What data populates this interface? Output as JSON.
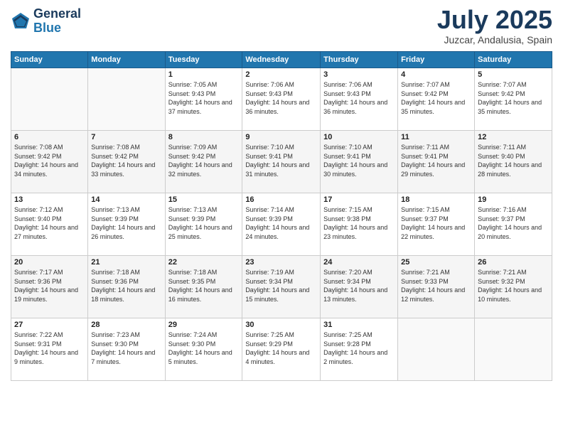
{
  "logo": {
    "line1": "General",
    "line2": "Blue"
  },
  "title": "July 2025",
  "subtitle": "Juzcar, Andalusia, Spain",
  "days_header": [
    "Sunday",
    "Monday",
    "Tuesday",
    "Wednesday",
    "Thursday",
    "Friday",
    "Saturday"
  ],
  "weeks": [
    [
      {
        "day": "",
        "sunrise": "",
        "sunset": "",
        "daylight": ""
      },
      {
        "day": "",
        "sunrise": "",
        "sunset": "",
        "daylight": ""
      },
      {
        "day": "1",
        "sunrise": "Sunrise: 7:05 AM",
        "sunset": "Sunset: 9:43 PM",
        "daylight": "Daylight: 14 hours and 37 minutes."
      },
      {
        "day": "2",
        "sunrise": "Sunrise: 7:06 AM",
        "sunset": "Sunset: 9:43 PM",
        "daylight": "Daylight: 14 hours and 36 minutes."
      },
      {
        "day": "3",
        "sunrise": "Sunrise: 7:06 AM",
        "sunset": "Sunset: 9:43 PM",
        "daylight": "Daylight: 14 hours and 36 minutes."
      },
      {
        "day": "4",
        "sunrise": "Sunrise: 7:07 AM",
        "sunset": "Sunset: 9:42 PM",
        "daylight": "Daylight: 14 hours and 35 minutes."
      },
      {
        "day": "5",
        "sunrise": "Sunrise: 7:07 AM",
        "sunset": "Sunset: 9:42 PM",
        "daylight": "Daylight: 14 hours and 35 minutes."
      }
    ],
    [
      {
        "day": "6",
        "sunrise": "Sunrise: 7:08 AM",
        "sunset": "Sunset: 9:42 PM",
        "daylight": "Daylight: 14 hours and 34 minutes."
      },
      {
        "day": "7",
        "sunrise": "Sunrise: 7:08 AM",
        "sunset": "Sunset: 9:42 PM",
        "daylight": "Daylight: 14 hours and 33 minutes."
      },
      {
        "day": "8",
        "sunrise": "Sunrise: 7:09 AM",
        "sunset": "Sunset: 9:42 PM",
        "daylight": "Daylight: 14 hours and 32 minutes."
      },
      {
        "day": "9",
        "sunrise": "Sunrise: 7:10 AM",
        "sunset": "Sunset: 9:41 PM",
        "daylight": "Daylight: 14 hours and 31 minutes."
      },
      {
        "day": "10",
        "sunrise": "Sunrise: 7:10 AM",
        "sunset": "Sunset: 9:41 PM",
        "daylight": "Daylight: 14 hours and 30 minutes."
      },
      {
        "day": "11",
        "sunrise": "Sunrise: 7:11 AM",
        "sunset": "Sunset: 9:41 PM",
        "daylight": "Daylight: 14 hours and 29 minutes."
      },
      {
        "day": "12",
        "sunrise": "Sunrise: 7:11 AM",
        "sunset": "Sunset: 9:40 PM",
        "daylight": "Daylight: 14 hours and 28 minutes."
      }
    ],
    [
      {
        "day": "13",
        "sunrise": "Sunrise: 7:12 AM",
        "sunset": "Sunset: 9:40 PM",
        "daylight": "Daylight: 14 hours and 27 minutes."
      },
      {
        "day": "14",
        "sunrise": "Sunrise: 7:13 AM",
        "sunset": "Sunset: 9:39 PM",
        "daylight": "Daylight: 14 hours and 26 minutes."
      },
      {
        "day": "15",
        "sunrise": "Sunrise: 7:13 AM",
        "sunset": "Sunset: 9:39 PM",
        "daylight": "Daylight: 14 hours and 25 minutes."
      },
      {
        "day": "16",
        "sunrise": "Sunrise: 7:14 AM",
        "sunset": "Sunset: 9:39 PM",
        "daylight": "Daylight: 14 hours and 24 minutes."
      },
      {
        "day": "17",
        "sunrise": "Sunrise: 7:15 AM",
        "sunset": "Sunset: 9:38 PM",
        "daylight": "Daylight: 14 hours and 23 minutes."
      },
      {
        "day": "18",
        "sunrise": "Sunrise: 7:15 AM",
        "sunset": "Sunset: 9:37 PM",
        "daylight": "Daylight: 14 hours and 22 minutes."
      },
      {
        "day": "19",
        "sunrise": "Sunrise: 7:16 AM",
        "sunset": "Sunset: 9:37 PM",
        "daylight": "Daylight: 14 hours and 20 minutes."
      }
    ],
    [
      {
        "day": "20",
        "sunrise": "Sunrise: 7:17 AM",
        "sunset": "Sunset: 9:36 PM",
        "daylight": "Daylight: 14 hours and 19 minutes."
      },
      {
        "day": "21",
        "sunrise": "Sunrise: 7:18 AM",
        "sunset": "Sunset: 9:36 PM",
        "daylight": "Daylight: 14 hours and 18 minutes."
      },
      {
        "day": "22",
        "sunrise": "Sunrise: 7:18 AM",
        "sunset": "Sunset: 9:35 PM",
        "daylight": "Daylight: 14 hours and 16 minutes."
      },
      {
        "day": "23",
        "sunrise": "Sunrise: 7:19 AM",
        "sunset": "Sunset: 9:34 PM",
        "daylight": "Daylight: 14 hours and 15 minutes."
      },
      {
        "day": "24",
        "sunrise": "Sunrise: 7:20 AM",
        "sunset": "Sunset: 9:34 PM",
        "daylight": "Daylight: 14 hours and 13 minutes."
      },
      {
        "day": "25",
        "sunrise": "Sunrise: 7:21 AM",
        "sunset": "Sunset: 9:33 PM",
        "daylight": "Daylight: 14 hours and 12 minutes."
      },
      {
        "day": "26",
        "sunrise": "Sunrise: 7:21 AM",
        "sunset": "Sunset: 9:32 PM",
        "daylight": "Daylight: 14 hours and 10 minutes."
      }
    ],
    [
      {
        "day": "27",
        "sunrise": "Sunrise: 7:22 AM",
        "sunset": "Sunset: 9:31 PM",
        "daylight": "Daylight: 14 hours and 9 minutes."
      },
      {
        "day": "28",
        "sunrise": "Sunrise: 7:23 AM",
        "sunset": "Sunset: 9:30 PM",
        "daylight": "Daylight: 14 hours and 7 minutes."
      },
      {
        "day": "29",
        "sunrise": "Sunrise: 7:24 AM",
        "sunset": "Sunset: 9:30 PM",
        "daylight": "Daylight: 14 hours and 5 minutes."
      },
      {
        "day": "30",
        "sunrise": "Sunrise: 7:25 AM",
        "sunset": "Sunset: 9:29 PM",
        "daylight": "Daylight: 14 hours and 4 minutes."
      },
      {
        "day": "31",
        "sunrise": "Sunrise: 7:25 AM",
        "sunset": "Sunset: 9:28 PM",
        "daylight": "Daylight: 14 hours and 2 minutes."
      },
      {
        "day": "",
        "sunrise": "",
        "sunset": "",
        "daylight": ""
      },
      {
        "day": "",
        "sunrise": "",
        "sunset": "",
        "daylight": ""
      }
    ]
  ]
}
